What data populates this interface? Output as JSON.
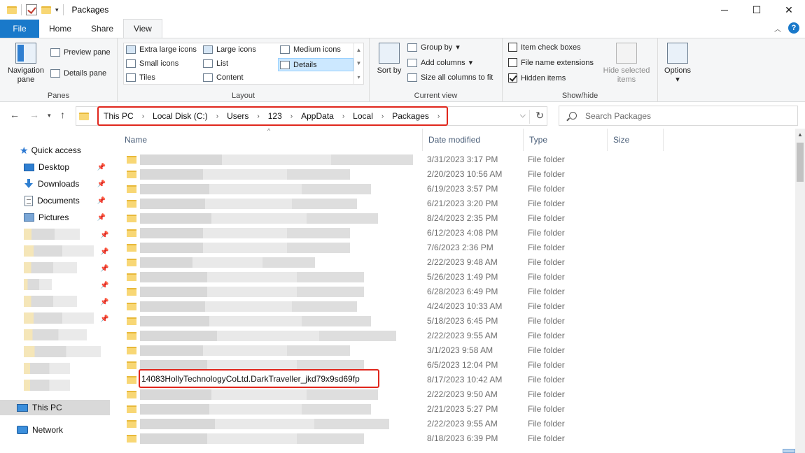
{
  "window": {
    "title": "Packages",
    "minimize": "─",
    "maximize": "☐",
    "close": "✕"
  },
  "ribbon_tabs": [
    "File",
    "Home",
    "Share",
    "View"
  ],
  "ribbon": {
    "panes": {
      "navigation_pane": "Navigation pane",
      "preview_pane": "Preview pane",
      "details_pane": "Details pane",
      "label": "Panes"
    },
    "layout": {
      "items": [
        "Extra large icons",
        "Large icons",
        "Medium icons",
        "Small icons",
        "List",
        "Details",
        "Tiles",
        "Content"
      ],
      "selected": "Details",
      "label": "Layout"
    },
    "current_view": {
      "sort_by": "Sort by",
      "group_by": "Group by",
      "add_columns": "Add columns",
      "size_all_columns": "Size all columns to fit",
      "label": "Current view"
    },
    "show_hide": {
      "item_check_boxes": "Item check boxes",
      "file_name_extensions": "File name extensions",
      "hidden_items": "Hidden items",
      "hide_selected_items": "Hide selected items",
      "label": "Show/hide"
    },
    "options": "Options"
  },
  "address": {
    "crumbs": [
      "This PC",
      "Local Disk (C:)",
      "Users",
      "123",
      "AppData",
      "Local",
      "Packages"
    ],
    "search_placeholder": "Search Packages"
  },
  "nav_pane": {
    "quick_access": "Quick access",
    "pinned": [
      "Desktop",
      "Downloads",
      "Documents",
      "Pictures"
    ],
    "this_pc": "This PC",
    "network": "Network"
  },
  "columns": [
    "Name",
    "Date modified",
    "Type",
    "Size"
  ],
  "rows": [
    {
      "date": "3/31/2023 3:17 PM",
      "type": "File folder"
    },
    {
      "date": "2/20/2023 10:56 AM",
      "type": "File folder"
    },
    {
      "date": "6/19/2023 3:57 PM",
      "type": "File folder"
    },
    {
      "date": "6/21/2023 3:20 PM",
      "type": "File folder"
    },
    {
      "date": "8/24/2023 2:35 PM",
      "type": "File folder"
    },
    {
      "date": "6/12/2023 4:08 PM",
      "type": "File folder"
    },
    {
      "date": "7/6/2023 2:36 PM",
      "type": "File folder"
    },
    {
      "date": "2/22/2023 9:48 AM",
      "type": "File folder"
    },
    {
      "date": "5/26/2023 1:49 PM",
      "type": "File folder"
    },
    {
      "date": "6/28/2023 6:49 PM",
      "type": "File folder"
    },
    {
      "date": "4/24/2023 10:33 AM",
      "type": "File folder"
    },
    {
      "date": "5/18/2023 6:45 PM",
      "type": "File folder"
    },
    {
      "date": "2/22/2023 9:55 AM",
      "type": "File folder"
    },
    {
      "date": "3/1/2023 9:58 AM",
      "type": "File folder"
    },
    {
      "date": "6/5/2023 12:04 PM",
      "type": "File folder"
    },
    {
      "date": "8/17/2023 10:42 AM",
      "type": "File folder",
      "name": "14083HollyTechnologyCoLtd.DarkTraveller_jkd79x9sd69fp"
    },
    {
      "date": "2/22/2023 9:50 AM",
      "type": "File folder"
    },
    {
      "date": "2/21/2023 5:27 PM",
      "type": "File folder"
    },
    {
      "date": "2/22/2023 9:55 AM",
      "type": "File folder"
    },
    {
      "date": "8/18/2023 6:39 PM",
      "type": "File folder"
    }
  ]
}
